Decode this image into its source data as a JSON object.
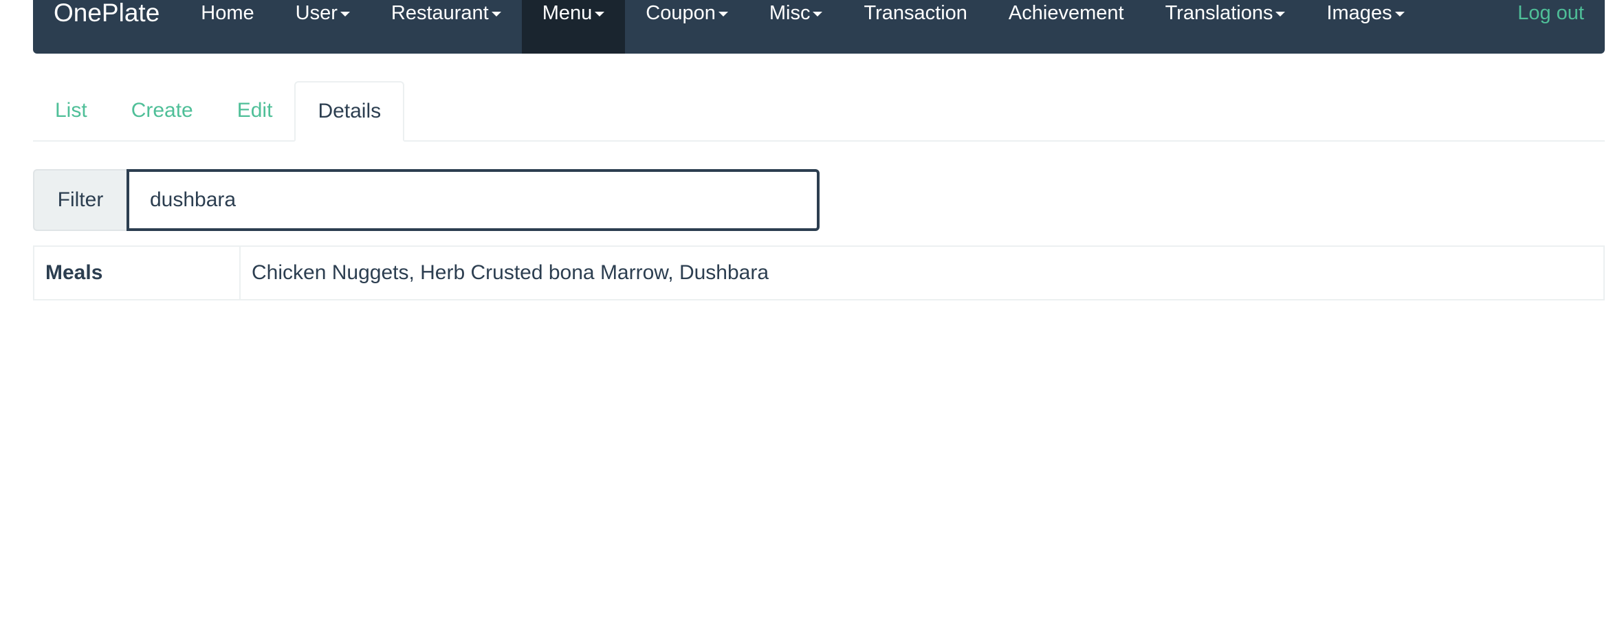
{
  "navbar": {
    "brand": "OnePlate",
    "items": [
      {
        "label": "Home",
        "dropdown": false,
        "active": false
      },
      {
        "label": "User",
        "dropdown": true,
        "active": false
      },
      {
        "label": "Restaurant",
        "dropdown": true,
        "active": false
      },
      {
        "label": "Menu",
        "dropdown": true,
        "active": true
      },
      {
        "label": "Coupon",
        "dropdown": true,
        "active": false
      },
      {
        "label": "Misc",
        "dropdown": true,
        "active": false
      },
      {
        "label": "Transaction",
        "dropdown": false,
        "active": false
      },
      {
        "label": "Achievement",
        "dropdown": false,
        "active": false
      },
      {
        "label": "Translations",
        "dropdown": true,
        "active": false
      },
      {
        "label": "Images",
        "dropdown": true,
        "active": false
      }
    ],
    "logout": "Log out",
    "colors": {
      "background": "#2c3e50",
      "active": "#1a252f",
      "link": "#4fbf98"
    }
  },
  "tabs": [
    {
      "label": "List",
      "active": false
    },
    {
      "label": "Create",
      "active": false
    },
    {
      "label": "Edit",
      "active": false
    },
    {
      "label": "Details",
      "active": true
    }
  ],
  "filter": {
    "label": "Filter",
    "value": "dushbara"
  },
  "details": {
    "rows": [
      {
        "label": "Meals",
        "value": "Chicken Nuggets, Herb Crusted bona Marrow, Dushbara"
      }
    ]
  }
}
